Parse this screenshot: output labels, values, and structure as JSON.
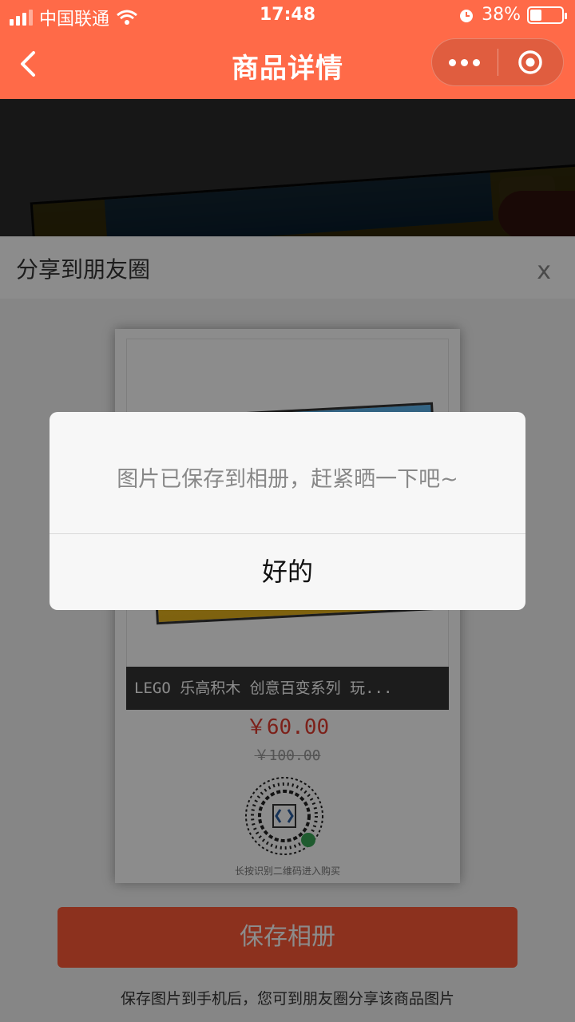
{
  "status_bar": {
    "carrier": "中国联通",
    "time": "17:48",
    "battery_percent": "38%",
    "battery_level": 0.38
  },
  "nav": {
    "title": "商品详情",
    "back_icon": "chevron-left-icon",
    "more_icon": "more-dots-icon",
    "close_icon": "target-circle-icon"
  },
  "share_sheet": {
    "title": "分享到朋友圈",
    "close_label": "x",
    "poster": {
      "product_name": "LEGO 乐高积木 创意百变系列 玩...",
      "price": "￥60.00",
      "original_price": "￥100.00",
      "qr_hint": "长按识别二维码进入购买"
    },
    "save_button_label": "保存相册",
    "save_note": "保存图片到手机后，您可到朋友圈分享该商品图片"
  },
  "dialog": {
    "message": "图片已保存到相册，赶紧晒一下吧~",
    "ok_label": "好的"
  },
  "colors": {
    "brand": "#ff6a48",
    "price_red": "#e23b2e",
    "button": "#ff5a37"
  }
}
